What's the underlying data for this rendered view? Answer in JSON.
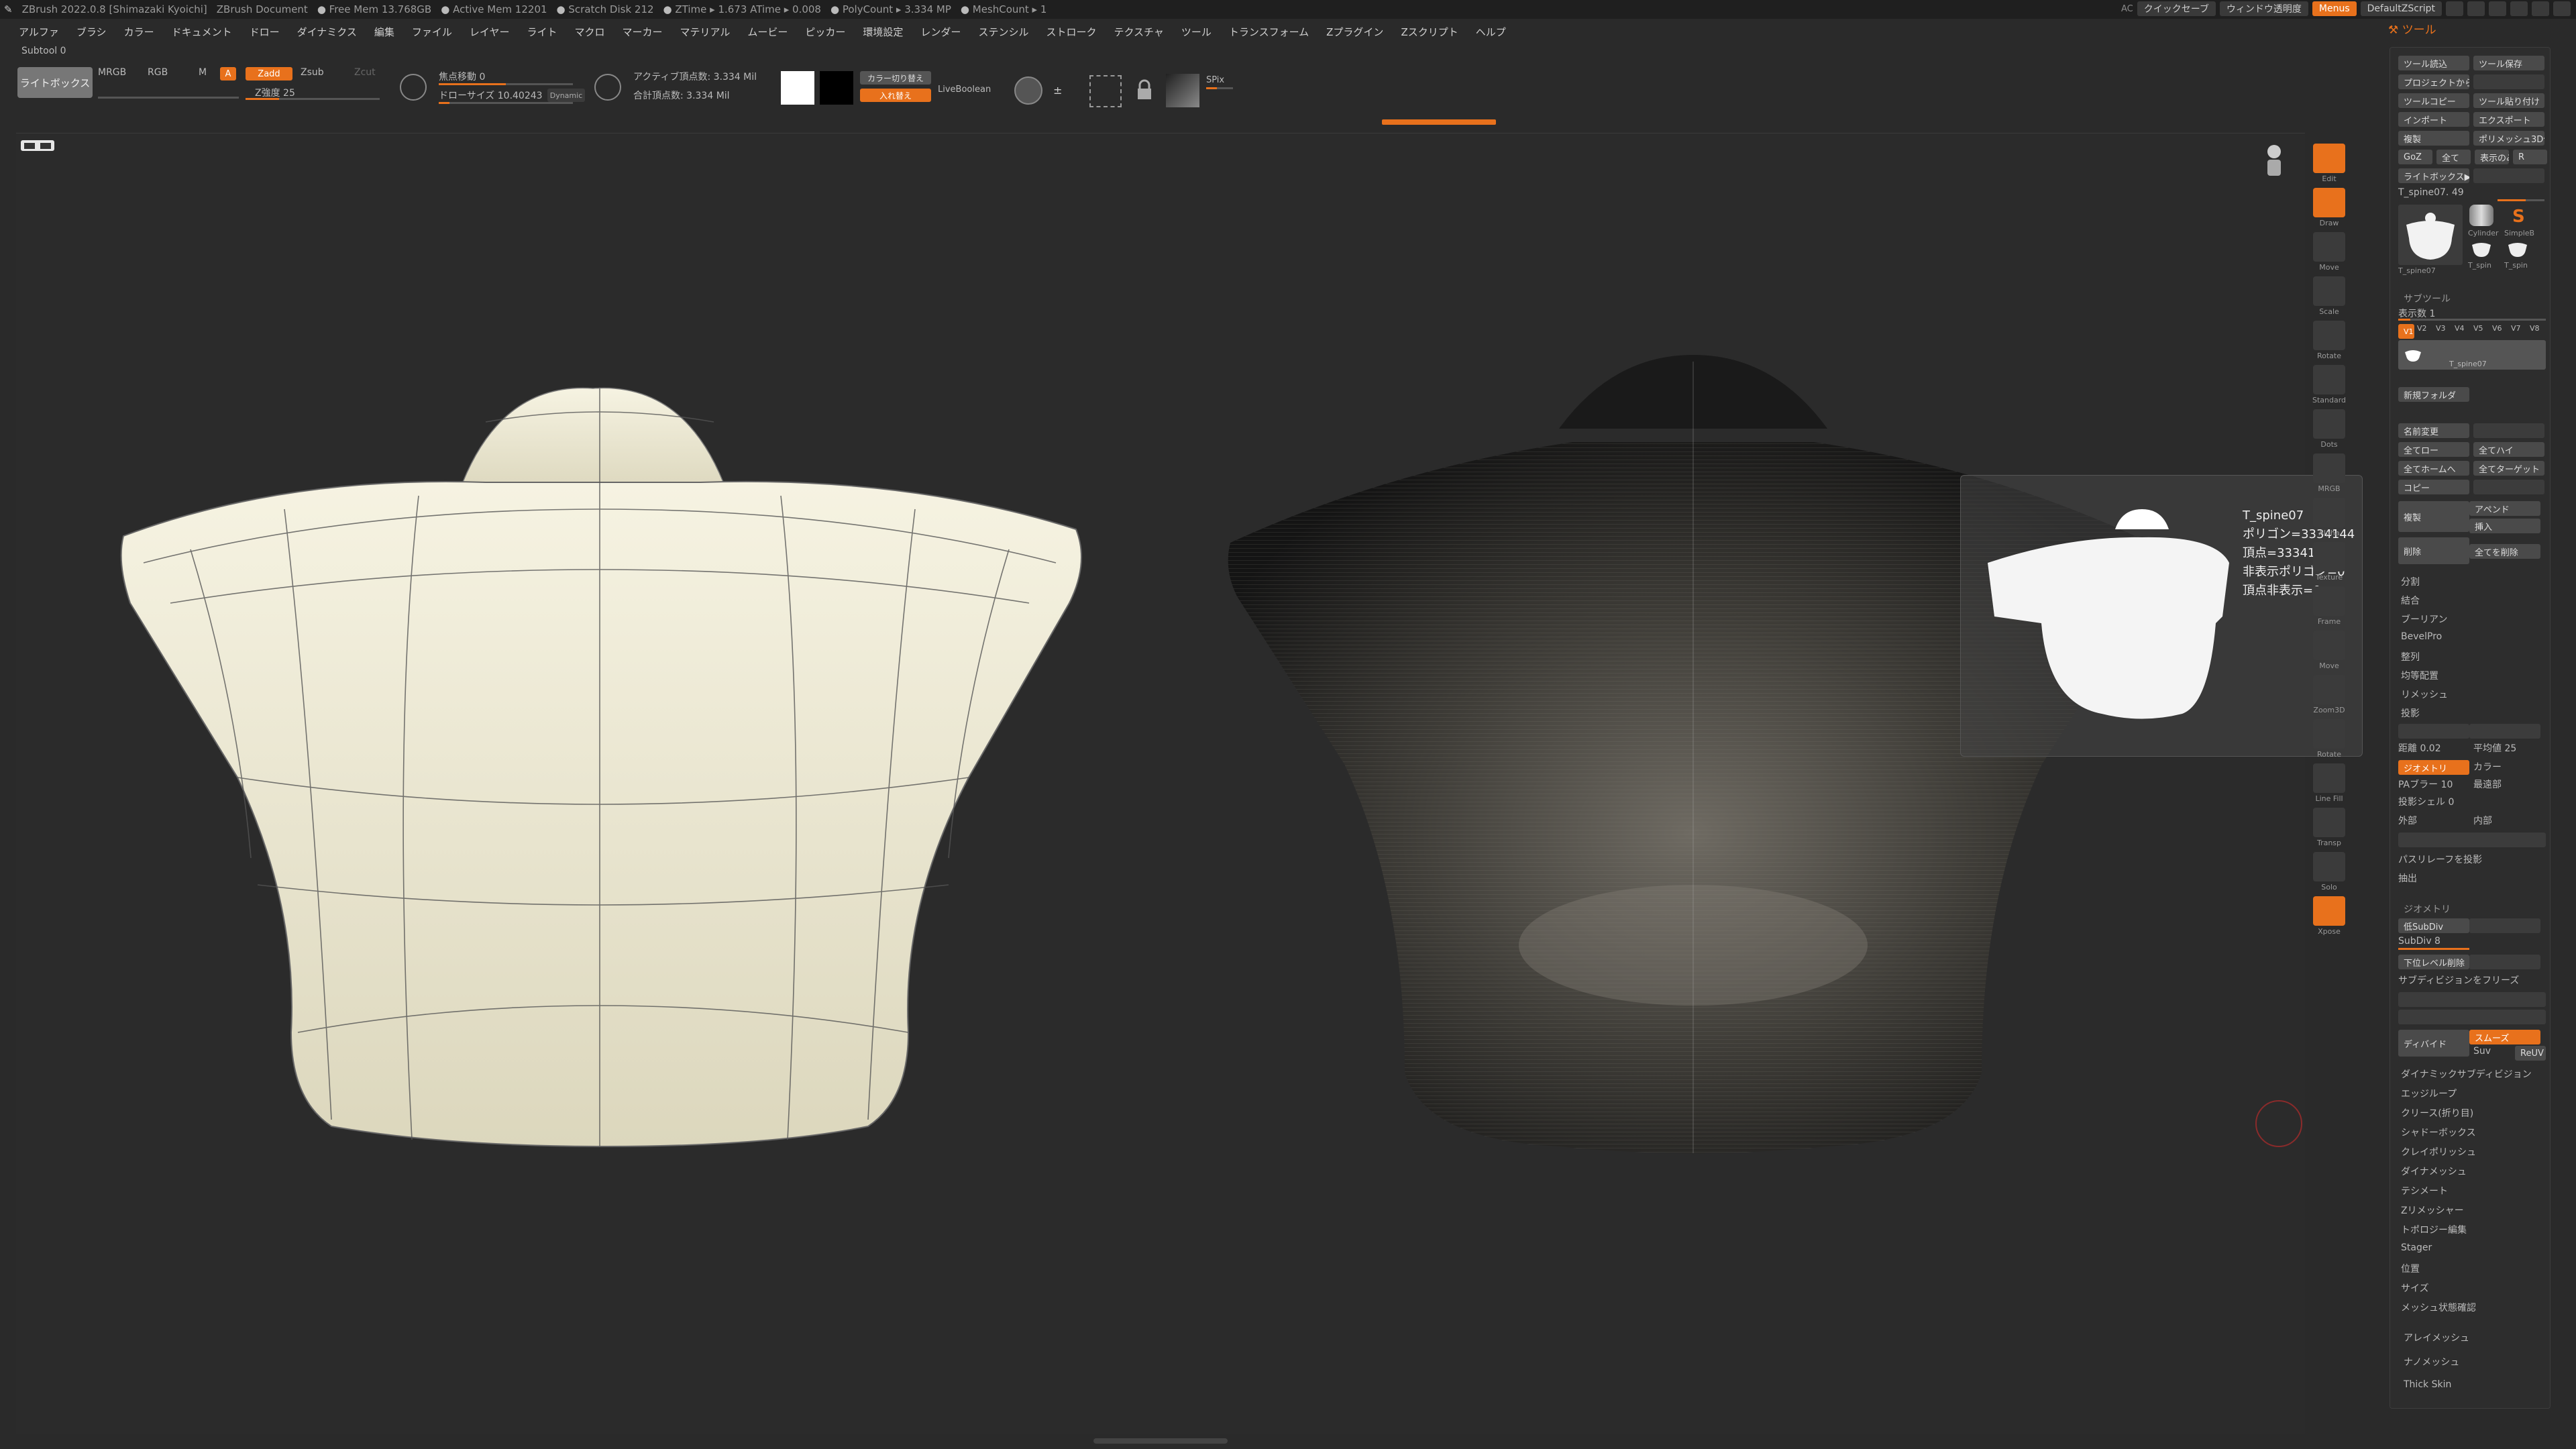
{
  "titlebar": {
    "app": "ZBrush 2022.0.8 [Shimazaki Kyoichi]",
    "doc": "ZBrush Document",
    "stats": [
      "Free Mem 13.768GB",
      "Active Mem 12201",
      "Scratch Disk 212",
      "ZTime ▸ 1.673 ATime ▸ 0.008",
      "PolyCount ▸ 3.334 MP",
      "MeshCount ▸ 1"
    ],
    "ac": "AC",
    "quicksave": "クイックセーブ",
    "window_opacity": "ウィンドウ透明度",
    "menus": "Menus",
    "default_script": "DefaultZScript"
  },
  "menu": [
    "アルファ",
    "ブラシ",
    "カラー",
    "ドキュメント",
    "ドロー",
    "ダイナミクス",
    "編集",
    "ファイル",
    "レイヤー",
    "ライト",
    "マクロ",
    "マーカー",
    "マテリアル",
    "ムービー",
    "ピッカー",
    "環境設定",
    "レンダー",
    "ステンシル",
    "ストローク",
    "テクスチャ",
    "ツール",
    "トランスフォーム",
    "Zプラグイン",
    "Zスクリプト",
    "ヘルプ"
  ],
  "subtool_label": "Subtool 0",
  "toolbar": {
    "lightbox": "ライトボックス",
    "mrgb": "MRGB",
    "rgb": "RGB",
    "m": "M",
    "a": "A",
    "zadd": "Zadd",
    "zsub": "Zsub",
    "zcut": "Zcut",
    "z_intensity": "Z強度 25",
    "focal_shift": "焦点移動 0",
    "draw_size": "ドローサイズ 10.40243",
    "dynamic": "Dynamic",
    "active_points": "アクティブ頂点数: 3.334 Mil",
    "total_points": "合計頂点数: 3.334 Mil",
    "swap_color": "カラー切り替え",
    "swap_in": "入れ替え",
    "live_boolean": "LiveBoolean",
    "spix": "SPix"
  },
  "popup": {
    "name": "T_spine07",
    "polygons": "ポリゴン=3334144",
    "points": "頂点=3334146",
    "hidden_polys": "非表示ポリゴン=0",
    "hidden_points": "頂点非表示=0"
  },
  "strip": [
    "Edit",
    "Draw",
    "Move",
    "Scale",
    "Rotate",
    "Standard",
    "Dots",
    "MRGB",
    "Alpha",
    "Texture",
    "Frame",
    "Move",
    "Zoom3D",
    "Rotate",
    "Line Fill",
    "Transp",
    "Solo",
    "Xpose"
  ],
  "panel": {
    "title": "ツール",
    "buttons_top": [
      [
        "ツール読込",
        "ツール保存"
      ],
      [
        "プロジェクトからツール読込",
        ""
      ],
      [
        "ツールコピー",
        "ツール貼り付け"
      ],
      [
        "インポート",
        "エクスポート"
      ],
      [
        "複製",
        "ポリメッシュ3D化"
      ],
      [
        "GoZ",
        "全て",
        "表示のみ",
        "R"
      ],
      [
        "ライトボックス▶ツール",
        ""
      ]
    ],
    "tool_name": "T_spine07. 49",
    "thumb_labels": [
      "T_spine07",
      "Cylinder",
      "SimpleB",
      "T_spin",
      "T_spin"
    ],
    "subtool_head": "サブツール",
    "visible_count": "表示数 1",
    "versions": [
      "V1",
      "V2",
      "V3",
      "V4",
      "V5",
      "V6",
      "V7",
      "V8"
    ],
    "subtool_item": "T_spine07",
    "new_folder": "新規フォルダ",
    "rename": "名前変更",
    "all_low": "全てロー",
    "all_high": "全てハイ",
    "all_home": "全てホームへ",
    "all_target": "全てターゲット",
    "copy": "コピー",
    "duplicate": "複製",
    "append": "アペンド",
    "insert": "挿入",
    "delete": "削除",
    "delete_all": "全てを削除",
    "sub_items": [
      "分割",
      "結合",
      "ブーリアン",
      "BevelPro",
      "整列",
      "均等配置",
      "リメッシュ"
    ],
    "project": "投影",
    "distance": "距離 0.02",
    "mean": "平均値 25",
    "geometry_btn": "ジオメトリ",
    "color_btn": "カラー",
    "pa_blur": "PAブラー 10",
    "farthest": "最遠部",
    "proj_shell": "投影シェル 0",
    "outer": "外部",
    "inner": "内部",
    "polish_project": "パスリレーフを投影",
    "extract": "抽出",
    "geometry_head": "ジオメトリ",
    "lower_subdiv": "低SubDiv",
    "subdiv": "SubDiv 8",
    "del_lower": "下位レベル削除",
    "freeze_subdiv": "サブディビジョンをフリーズ",
    "divide": "ディバイド",
    "smooth": "スムーズ",
    "suv": "Suv",
    "reuv": "ReUV",
    "geo_items": [
      "ダイナミックサブディビジョン",
      "エッジループ",
      "クリース(折り目)",
      "シャドーボックス",
      "クレイポリッシュ",
      "ダイナメッシュ",
      "テシメート",
      "Zリメッシャー",
      "トポロジー編集",
      "Stager",
      "位置",
      "サイズ",
      "メッシュ状態確認"
    ],
    "after": [
      "アレイメッシュ",
      "ナノメッシュ",
      "Thick Skin"
    ]
  }
}
